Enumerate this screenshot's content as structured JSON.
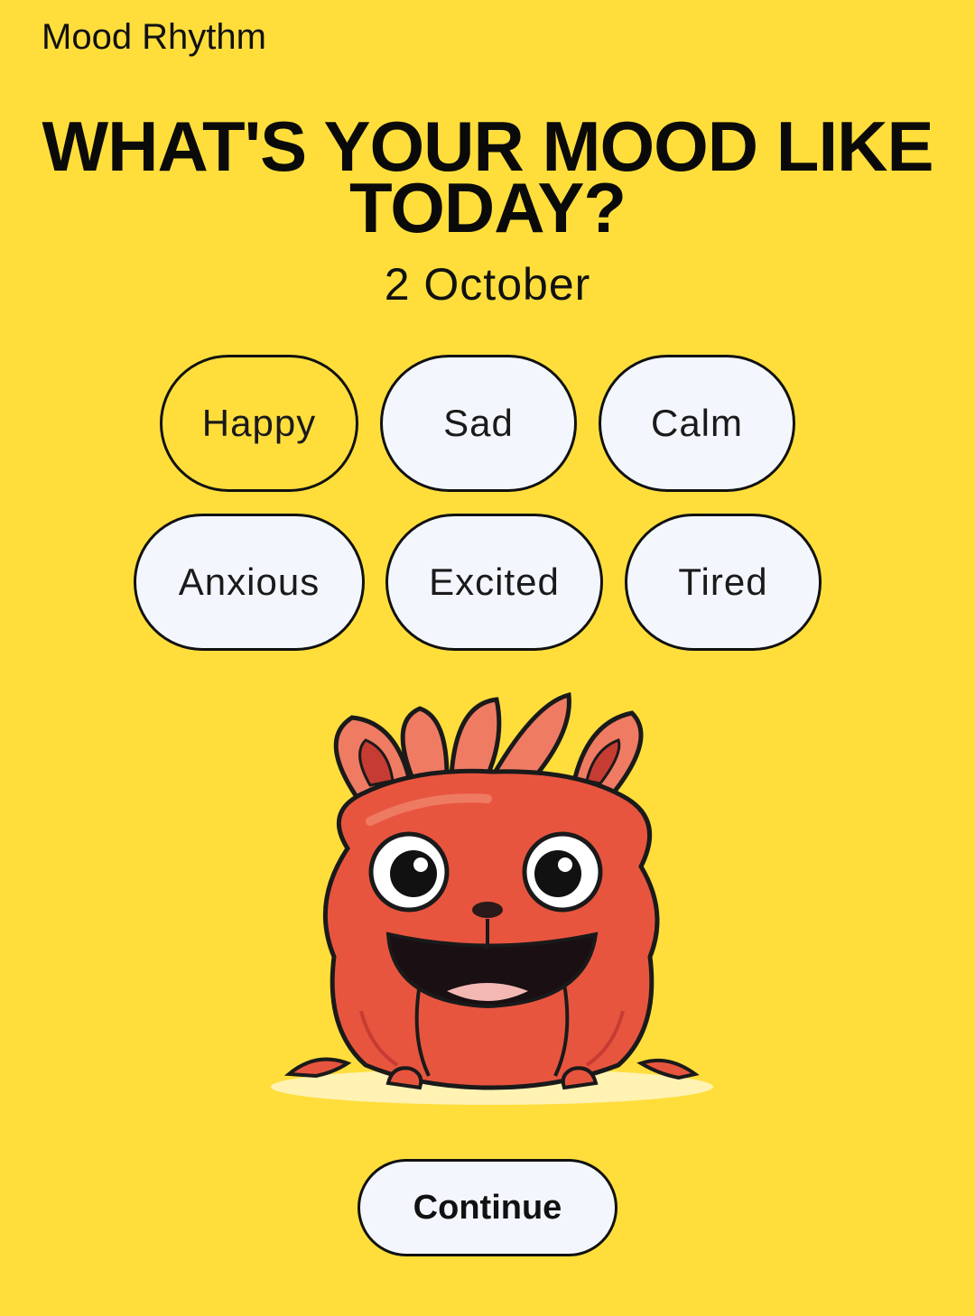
{
  "header": {
    "app_title": "Mood Rhythm"
  },
  "prompt": {
    "headline_line1": "WHAT'S YOUR MOOD LIKE",
    "headline_line2": "TODAY?",
    "date": "2 October"
  },
  "moods": [
    {
      "label": "Happy",
      "selected": true
    },
    {
      "label": "Sad",
      "selected": false
    },
    {
      "label": "Calm",
      "selected": false
    },
    {
      "label": "Anxious",
      "selected": false
    },
    {
      "label": "Excited",
      "selected": false
    },
    {
      "label": "Tired",
      "selected": false
    }
  ],
  "illustration": {
    "icon": "red-monster-mascot"
  },
  "actions": {
    "continue_label": "Continue"
  },
  "colors": {
    "background": "#FFDE3C",
    "chip_fill": "#F3F7FD",
    "outline": "#111111",
    "mascot": "#E8553F"
  }
}
